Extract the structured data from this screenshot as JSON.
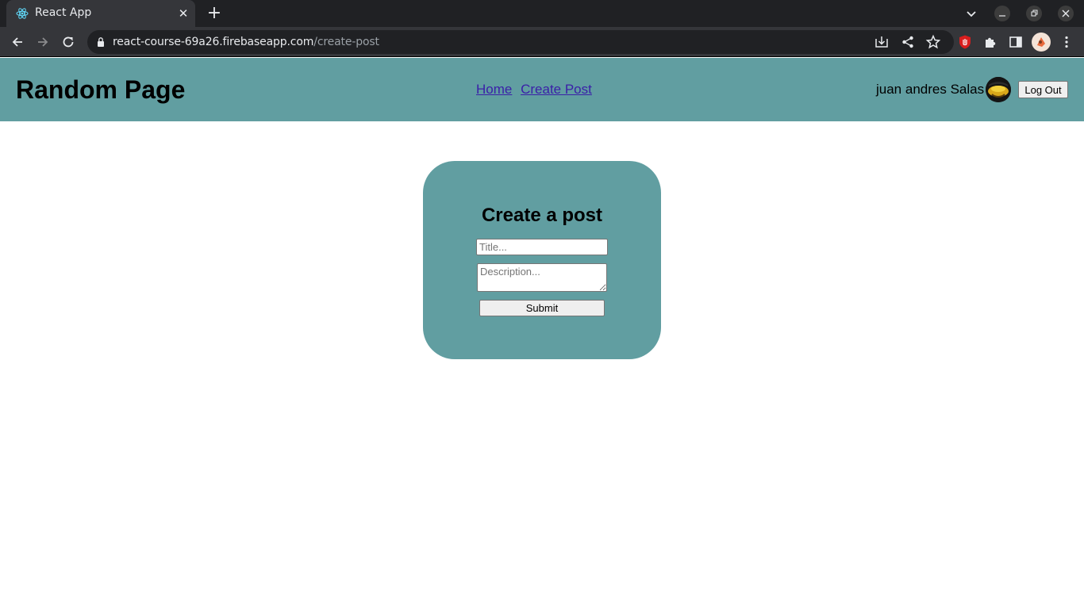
{
  "browser": {
    "tab_title": "React App",
    "tab_close": "✕",
    "new_tab": "+",
    "url_domain": "react-course-69a26.firebaseapp.com",
    "url_path": "/create-post",
    "icons": [
      "react-favicon",
      "back-arrow-icon",
      "forward-arrow-icon",
      "reload-icon",
      "lock-icon",
      "install-app-icon",
      "share-icon",
      "star-bookmark-icon",
      "extension-shield-icon",
      "puzzle-extensions-icon",
      "side-panel-icon",
      "profile-avatar-icon",
      "kebab-menu-icon",
      "chevron-down-icon",
      "minimize-icon",
      "restore-icon",
      "close-window-icon"
    ]
  },
  "navbar": {
    "brand": "Random Page",
    "links": [
      "Home",
      "Create Post"
    ],
    "user_name": "juan andres Salas",
    "logout_label": "Log Out",
    "bg_color": "#619ea1"
  },
  "form": {
    "heading": "Create a post",
    "title_placeholder": "Title...",
    "description_placeholder": "Description...",
    "submit_label": "Submit"
  }
}
